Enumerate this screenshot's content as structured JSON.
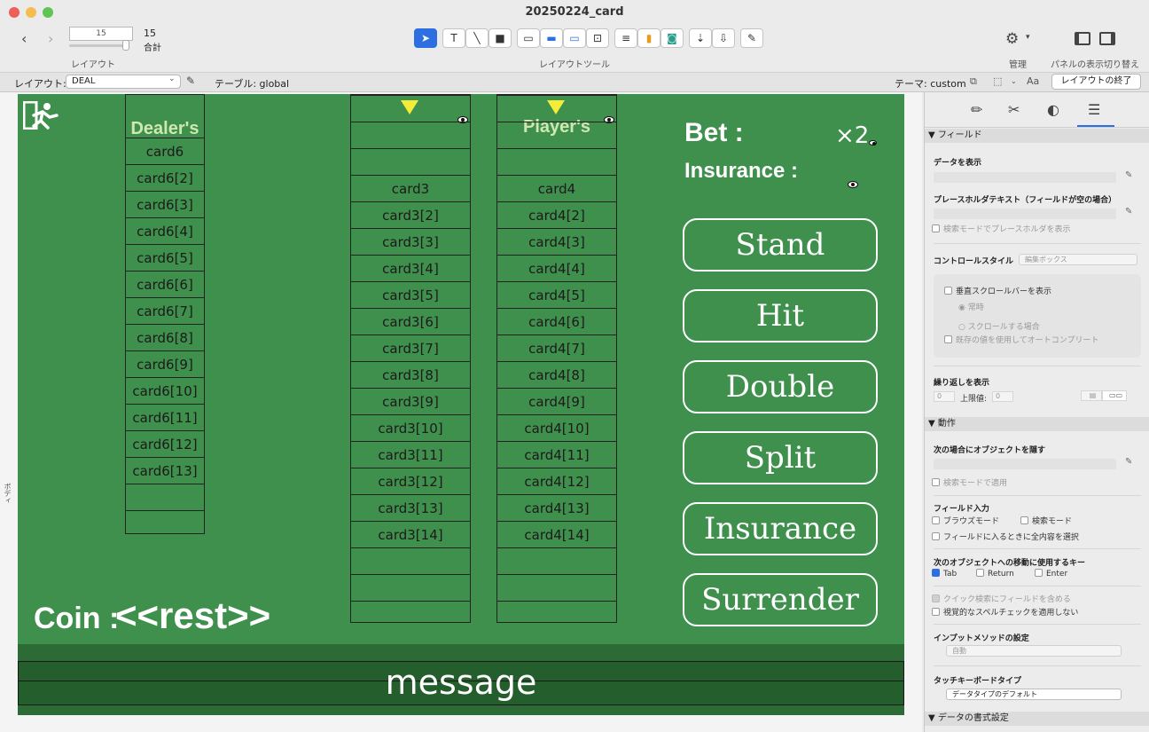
{
  "window": {
    "title": "20250224_card"
  },
  "toolbar": {
    "page_field": "15",
    "page_number": "15",
    "page_total_label": "合計",
    "layout_label": "レイアウト",
    "layout_tools_label": "レイアウトツール",
    "manage_label": "管理",
    "panel_toggle_label": "パネルの表示切り替え"
  },
  "layout_bar": {
    "layout_label": "レイアウト:",
    "layout_value": "DEAL",
    "table_label": "テーブル: global",
    "theme_label": "テーマ: custom",
    "exit_button": "レイアウトの終了"
  },
  "canvas": {
    "part_label": "ボディ",
    "dealer_header": "Dealer's",
    "player_header": "Player's",
    "dealer_cells": [
      "card6",
      "card6[2]",
      "card6[3]",
      "card6[4]",
      "card6[5]",
      "card6[6]",
      "card6[7]",
      "card6[8]",
      "card6[9]",
      "card6[10]",
      "card6[11]",
      "card6[12]",
      "card6[13]",
      "",
      ""
    ],
    "col2_cells": [
      "",
      "",
      "",
      "card3",
      "card3[2]",
      "card3[3]",
      "card3[4]",
      "card3[5]",
      "card3[6]",
      "card3[7]",
      "card3[8]",
      "card3[9]",
      "card3[10]",
      "card3[11]",
      "card3[12]",
      "card3[13]",
      "card3[14]",
      "",
      "",
      ""
    ],
    "col3_cells": [
      "",
      "",
      "",
      "card4",
      "card4[2]",
      "card4[3]",
      "card4[4]",
      "card4[5]",
      "card4[6]",
      "card4[7]",
      "card4[8]",
      "card4[9]",
      "card4[10]",
      "card4[11]",
      "card4[12]",
      "card4[13]",
      "card4[14]",
      "",
      "",
      ""
    ],
    "bet_label": "Bet :",
    "multiplier": "×2",
    "insurance_label": "Insurance :",
    "buttons": [
      "Stand",
      "Hit",
      "Double",
      "Split",
      "Insurance",
      "Surrender"
    ],
    "coin_label": "Coin :",
    "coin_field": "<<rest>>",
    "message": "message",
    "colors": {
      "felt": "#3f8f4d",
      "footer": "#2c6a36",
      "marker": "#f4ec38"
    }
  },
  "inspector": {
    "section_field": "フィールド",
    "show_data": "データを表示",
    "placeholder_text": "プレースホルダテキスト（フィールドが空の場合）",
    "placeholder_find": "検索モードでプレースホルダを表示",
    "control_style": "コントロールスタイル",
    "control_style_value": "編集ボックス",
    "vscroll": "垂直スクロールバーを表示",
    "always": "常時",
    "when_scroll": "スクロールする場合",
    "autocomplete": "既存の値を使用してオートコンプリート",
    "repeat_label": "繰り返しを表示",
    "repeat_from": "0",
    "repeat_max_label": "上限値:",
    "repeat_max": "0",
    "section_behavior": "動作",
    "hide_when": "次の場合にオブジェクトを隠す",
    "apply_find": "検索モードで適用",
    "field_entry": "フィールド入力",
    "browse_mode": "ブラウズモード",
    "find_mode": "検索モード",
    "select_all": "フィールドに入るときに全内容を選択",
    "next_obj_keys": "次のオブジェクトへの移動に使用するキー",
    "key_tab": "Tab",
    "key_return": "Return",
    "key_enter": "Enter",
    "quick_find": "クイック検索にフィールドを含める",
    "no_spell": "視覚的なスペルチェックを適用しない",
    "input_method": "インプットメソッドの設定",
    "input_method_value": "自動",
    "touch_keyboard": "タッチキーボードタイプ",
    "touch_keyboard_value": "データタイプのデフォルト",
    "section_format": "データの書式設定"
  }
}
